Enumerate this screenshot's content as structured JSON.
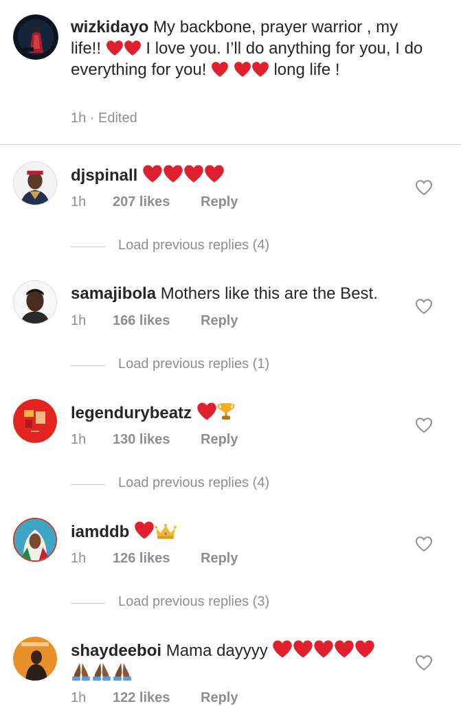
{
  "caption": {
    "username": "wizkidayo",
    "text_1": "My backbone, prayer warrior , my life!!",
    "text_2": "I love you. I’ll do anything for you, I do everything for you!",
    "text_3": "long life !",
    "meta": "1h · Edited"
  },
  "comments": [
    {
      "username": "djspinall",
      "text": "",
      "emoji": "heart x4",
      "time": "1h",
      "likes": "207 likes",
      "reply": "Reply",
      "load_replies": "Load previous replies (4)"
    },
    {
      "username": "samajibola",
      "text": "Mothers like this are the Best.",
      "time": "1h",
      "likes": "166 likes",
      "reply": "Reply",
      "load_replies": "Load previous replies (1)"
    },
    {
      "username": "legendurybeatz",
      "text": "",
      "emoji": "heart, trophy",
      "time": "1h",
      "likes": "130 likes",
      "reply": "Reply",
      "load_replies": "Load previous replies (4)"
    },
    {
      "username": "iamddb",
      "text": "",
      "emoji": "heart, crown",
      "time": "1h",
      "likes": "126 likes",
      "reply": "Reply",
      "load_replies": "Load previous replies (3)"
    },
    {
      "username": "shaydeeboi",
      "text": "Mama dayyyy",
      "emoji": "heart x5, folded-hands x3",
      "time": "1h",
      "likes": "122 likes",
      "reply": "Reply"
    }
  ],
  "icons": {
    "like": "heart-outline-icon",
    "emoji_heart": "red-heart-icon",
    "trophy": "trophy-icon",
    "crown": "crown-icon",
    "pray": "folded-hands-icon"
  },
  "colors": {
    "username": "#262626",
    "meta": "#8e8e8e",
    "heart": "#e0202e",
    "divider": "#dbdbdb"
  }
}
